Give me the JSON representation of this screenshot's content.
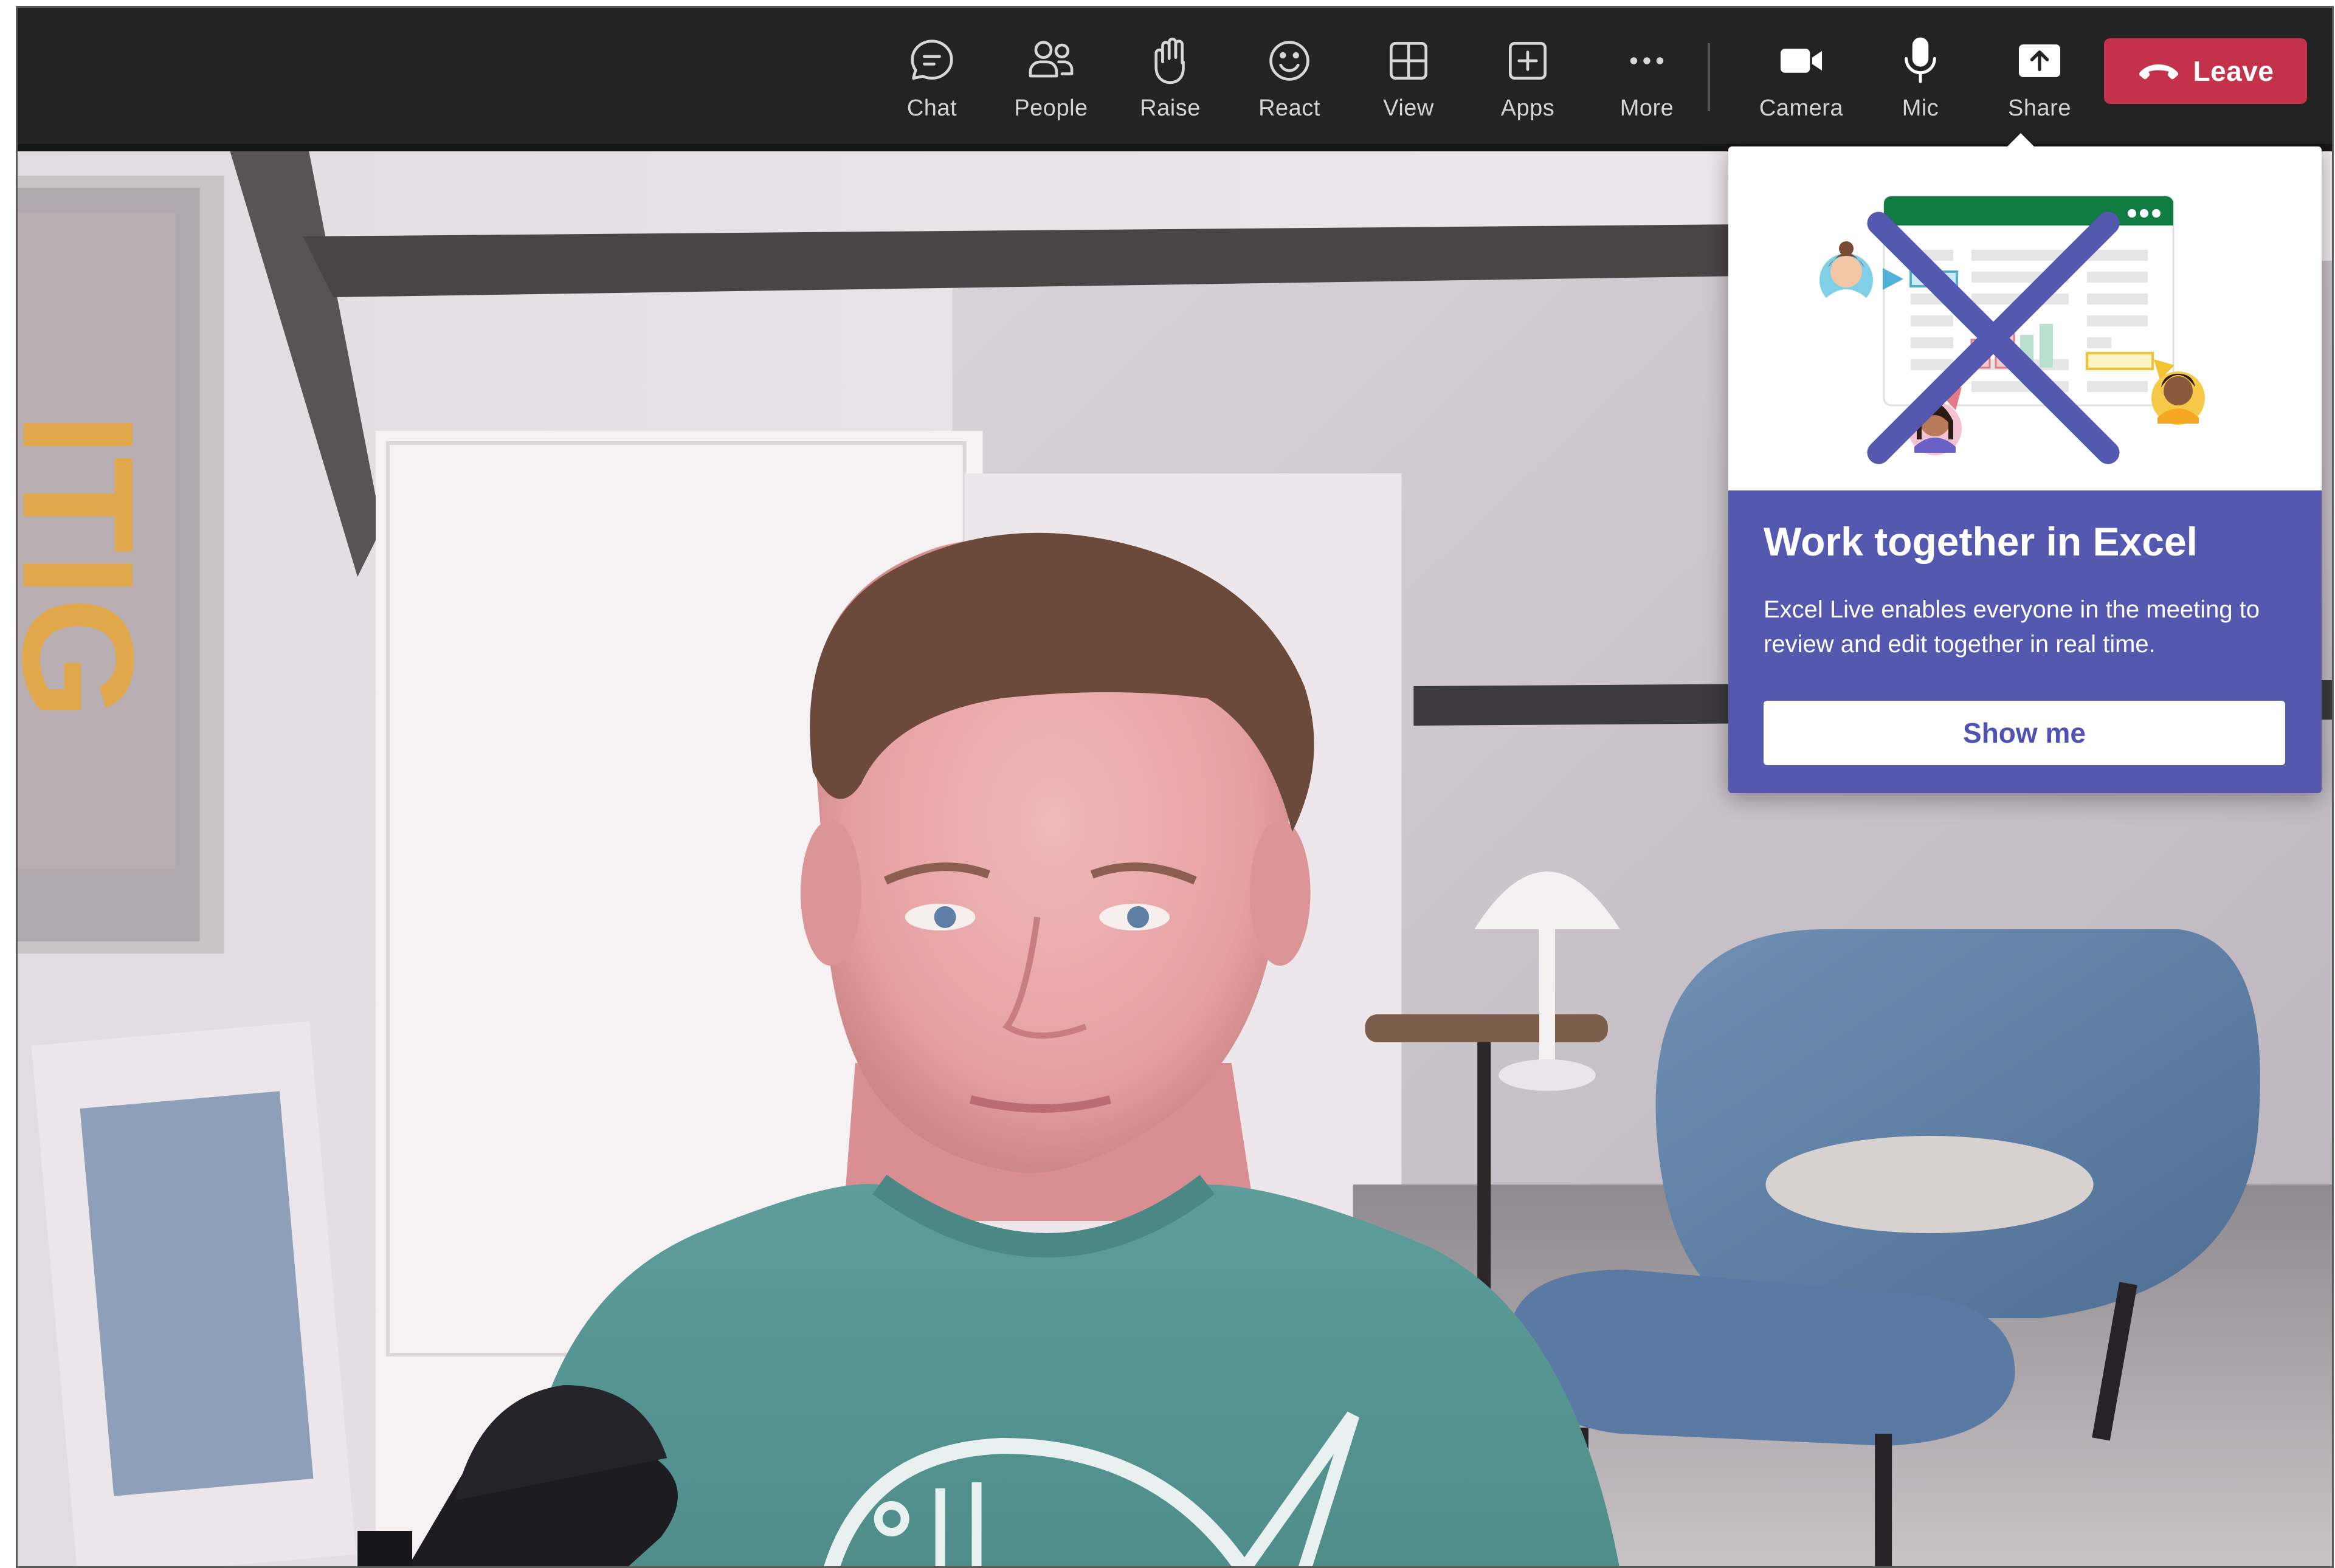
{
  "toolbar": {
    "items": [
      {
        "label": "Chat",
        "icon": "chat-icon"
      },
      {
        "label": "People",
        "icon": "people-icon"
      },
      {
        "label": "Raise",
        "icon": "raise-hand-icon"
      },
      {
        "label": "React",
        "icon": "react-smiley-icon"
      },
      {
        "label": "View",
        "icon": "view-grid-icon"
      },
      {
        "label": "Apps",
        "icon": "apps-plus-icon"
      },
      {
        "label": "More",
        "icon": "more-dots-icon"
      },
      {
        "label": "Camera",
        "icon": "camera-icon"
      },
      {
        "label": "Mic",
        "icon": "mic-icon"
      },
      {
        "label": "Share",
        "icon": "share-icon"
      }
    ],
    "leave": {
      "label": "Leave",
      "icon": "hang-up-icon",
      "color": "#c4314b"
    }
  },
  "callout": {
    "title": "Work together in Excel",
    "body": "Excel Live enables everyone in the meeting to review and edit together in real time.",
    "button": "Show me",
    "close_icon": "close-icon",
    "accent": "#5558af"
  },
  "colors": {
    "toolbar_bg": "#232323",
    "excel_green": "#107c41"
  }
}
